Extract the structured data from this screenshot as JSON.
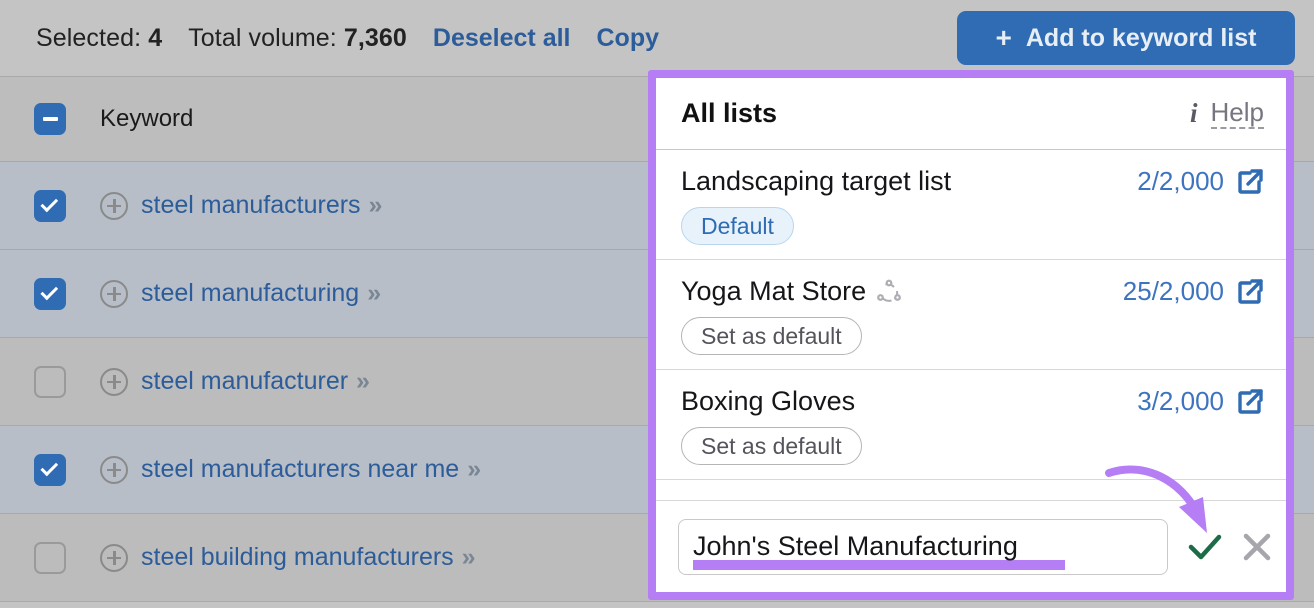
{
  "toolbar": {
    "selected_label": "Selected:",
    "selected_count": "4",
    "volume_label": "Total volume:",
    "volume_value": "7,360",
    "deselect_all": "Deselect all",
    "copy": "Copy",
    "add_button": "Add to keyword list",
    "add_button_plus": "+"
  },
  "table": {
    "header": {
      "column_keyword": "Keyword"
    },
    "rows": [
      {
        "keyword": "steel manufacturers",
        "checked": true
      },
      {
        "keyword": "steel manufacturing",
        "checked": true
      },
      {
        "keyword": "steel manufacturer",
        "checked": false
      },
      {
        "keyword": "steel manufacturers near me",
        "checked": true
      },
      {
        "keyword": "steel building manufacturers",
        "checked": false
      }
    ]
  },
  "panel": {
    "title": "All lists",
    "help_label": "Help",
    "info_icon": "info-icon",
    "lists": [
      {
        "name": "Landscaping target list",
        "count": "2/2,000",
        "badge": "Default",
        "badge_kind": "default",
        "has_share_icon": false
      },
      {
        "name": "Yoga Mat Store",
        "count": "25/2,000",
        "badge": "Set as default",
        "badge_kind": "setdef",
        "has_share_icon": true
      },
      {
        "name": "Boxing Gloves",
        "count": "3/2,000",
        "badge": "Set as default",
        "badge_kind": "setdef",
        "has_share_icon": false
      }
    ],
    "new_list": {
      "value": "John's Steel Manufacturing",
      "placeholder": "List name",
      "confirm_icon": "check-icon",
      "cancel_icon": "close-icon"
    }
  },
  "colors": {
    "accent_blue": "#2f6cb4",
    "link_blue": "#2c5c99",
    "annotation_purple": "#b57ef5",
    "confirm_green": "#1e6b48",
    "page_gray": "#c4c4c4"
  }
}
